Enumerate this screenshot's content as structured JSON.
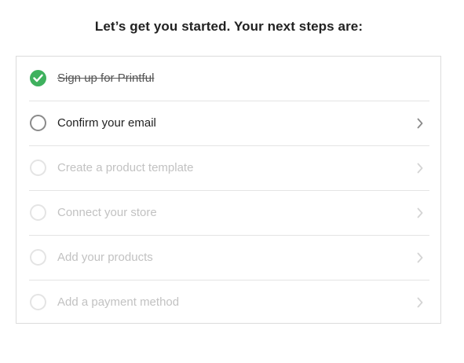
{
  "header": {
    "title": "Let’s get you started. Your next steps are:"
  },
  "steps": [
    {
      "label": "Sign up for Printful",
      "state": "completed"
    },
    {
      "label": "Confirm your email",
      "state": "current"
    },
    {
      "label": "Create a product template",
      "state": "pending"
    },
    {
      "label": "Connect your store",
      "state": "pending"
    },
    {
      "label": "Add your products",
      "state": "pending"
    },
    {
      "label": "Add a payment method",
      "state": "pending"
    }
  ],
  "colors": {
    "completed": "#3fb15e",
    "current_ring": "#8a8a8a",
    "pending_ring": "#e4e4e4",
    "chevron_active": "#8a8a8a",
    "chevron_pending": "#d4d4d4"
  },
  "icons": {
    "completed": "check-circle-icon",
    "current": "empty-circle-icon",
    "pending": "empty-circle-icon",
    "chevron": "chevron-right-icon"
  }
}
